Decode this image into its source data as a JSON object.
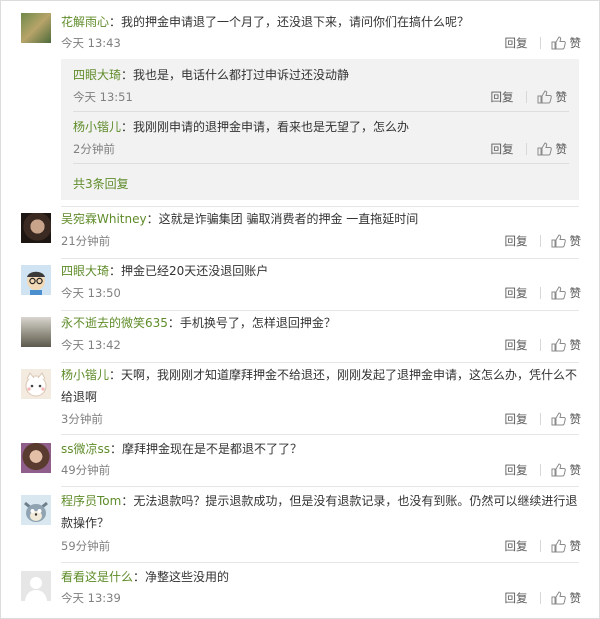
{
  "ui": {
    "reply_label": "回复",
    "like_label": "赞"
  },
  "comments": [
    {
      "user": "花解雨心",
      "sep": "：",
      "text": "我的押金申请退了一个月了，还没退下来，请问你们在搞什么呢？",
      "time": "今天 13:43",
      "replies": [
        {
          "user": "四眼大琦",
          "sep": "：",
          "text": "我也是，电话什么都打过申诉过还没动静",
          "time": "今天 13:51"
        },
        {
          "user": "杨小锴儿",
          "sep": "：",
          "text": "我刚刚申请的退押金申请，看来也是无望了，怎么办",
          "time": "2分钟前"
        }
      ],
      "more_replies": "共3条回复"
    },
    {
      "user": "吴宛霖Whitney",
      "sep": "：",
      "text": "这就是诈骗集团 骗取消费者的押金 一直拖延时间",
      "time": "21分钟前"
    },
    {
      "user": "四眼大琦",
      "sep": "：",
      "text": "押金已经20天还没退回账户",
      "time": "今天 13:50"
    },
    {
      "user": "永不逝去的微笑635",
      "sep": "：",
      "text": "手机换号了，怎样退回押金？",
      "time": "今天 13:42"
    },
    {
      "user": "杨小锴儿",
      "sep": "：",
      "text": "天啊，我刚刚才知道摩拜押金不给退还，刚刚发起了退押金申请，这怎么办，凭什么不给退啊",
      "time": "3分钟前"
    },
    {
      "user": "ss微凉ss",
      "sep": "：",
      "text": "摩拜押金现在是不是都退不了了？",
      "time": "49分钟前"
    },
    {
      "user": "程序员Tom",
      "sep": "：",
      "text": "无法退款吗？提示退款成功，但是没有退款记录，也没有到账。仍然可以继续进行退款操作？",
      "time": "59分钟前"
    },
    {
      "user": "看看这是什么",
      "sep": "：",
      "text": "净整这些没用的",
      "time": "今天 13:39"
    }
  ]
}
